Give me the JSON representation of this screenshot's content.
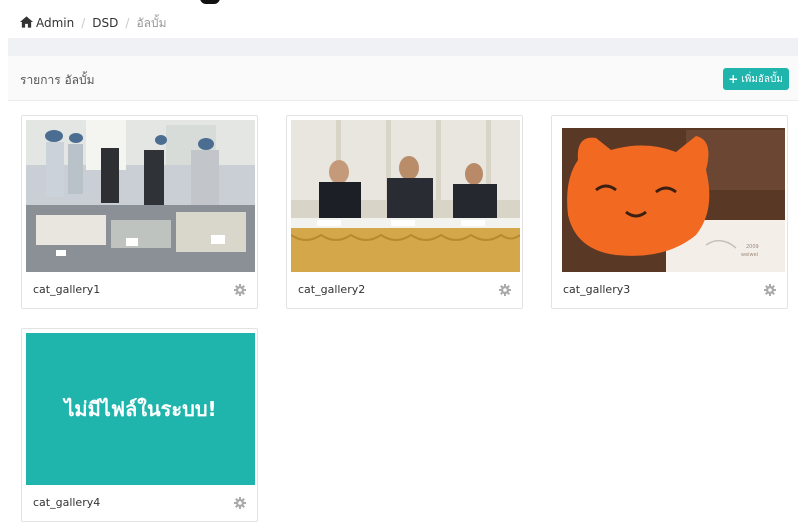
{
  "breadcrumb": {
    "items": [
      {
        "label": "Admin",
        "icon": "home-icon"
      },
      {
        "label": "DSD"
      },
      {
        "label": "อัลบั้ม",
        "active": true
      }
    ]
  },
  "panel": {
    "title": "รายการ อัลบั้ม",
    "add_button": {
      "label": "เพิ่มอัลบั้ม",
      "icon": "plus-icon"
    }
  },
  "albums": [
    {
      "name": "cat_gallery1",
      "thumbnail": "photo-factory-visit"
    },
    {
      "name": "cat_gallery2",
      "thumbnail": "photo-meeting-panel"
    },
    {
      "name": "cat_gallery3",
      "thumbnail": "photo-orange-plush"
    },
    {
      "name": "cat_gallery4",
      "thumbnail": "no-file",
      "placeholder": "ไม่มีไฟล์ในระบบ!"
    }
  ],
  "colors": {
    "accent": "#1fb5ad",
    "band": "#eff1f5",
    "panel_head": "#fafafa"
  }
}
